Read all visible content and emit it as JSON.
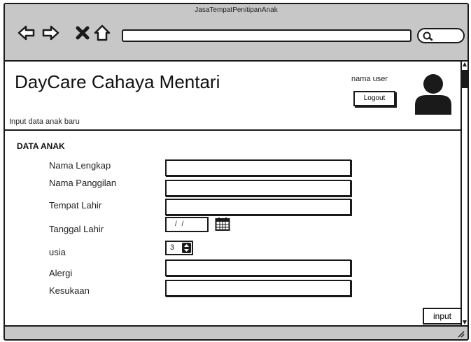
{
  "window": {
    "title": "JasaTempatPenitipanAnak"
  },
  "toolbar": {
    "back_icon": "arrow-left-icon",
    "forward_icon": "arrow-right-icon",
    "stop_icon": "close-icon",
    "home_icon": "home-icon",
    "search_icon": "search-icon",
    "url_value": ""
  },
  "header": {
    "app_title": "DayCare Cahaya Mentari",
    "user_name": "nama user",
    "logout_label": "Logout",
    "subtitle": "Input data anak baru"
  },
  "form": {
    "section_title": "DATA ANAK",
    "fields": {
      "full_name": {
        "label": "Nama Lengkap",
        "value": ""
      },
      "nickname": {
        "label": "Nama Panggilan",
        "value": ""
      },
      "birthplace": {
        "label": "Tempat Lahir",
        "value": ""
      },
      "birthdate": {
        "label": "Tanggal Lahir",
        "value": "/ /"
      },
      "age": {
        "label": "usia",
        "value": "3"
      },
      "allergy": {
        "label": "Alergi",
        "value": ""
      },
      "favorites": {
        "label": "Kesukaan",
        "value": ""
      }
    },
    "submit_label": "input"
  },
  "colors": {
    "chrome": "#c7c7c7",
    "ink": "#1a1a1a",
    "background": "#ffffff"
  }
}
